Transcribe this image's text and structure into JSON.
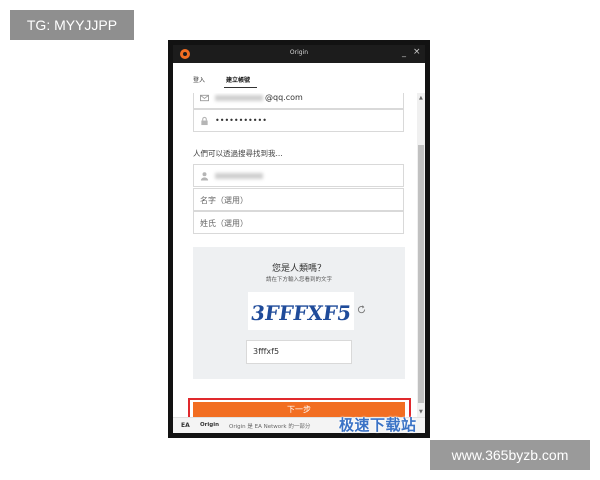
{
  "badges": {
    "top_left": "TG: MYYJJPP",
    "bottom_right": "www.365byzb.com"
  },
  "window": {
    "title": "Origin",
    "minimize": "_",
    "close": "×"
  },
  "tabs": [
    {
      "label": "登入"
    },
    {
      "label": "建立帳號"
    }
  ],
  "form": {
    "email_value": "@qq.com",
    "password_value": "•••••••••••",
    "discover_label": "人們可以透過搜尋找到我...",
    "first_name_placeholder": "名字（選用）",
    "last_name_placeholder": "姓氏（選用）"
  },
  "captcha": {
    "title": "您是人類嗎？",
    "subtitle": "請在下方輸入您看到的文字",
    "image_text": "3FFFXF5",
    "input_value": "3fffxf5"
  },
  "next_button": {
    "label": "下一步"
  },
  "footer": {
    "ea": "EA",
    "origin": "Origin",
    "text": "Origin 是 EA Network 的一部分"
  },
  "watermark": "极速下载站",
  "colors": {
    "accent": "#f26e22",
    "highlight_outline": "#e0292d",
    "titlebar": "#1c1c1c"
  }
}
